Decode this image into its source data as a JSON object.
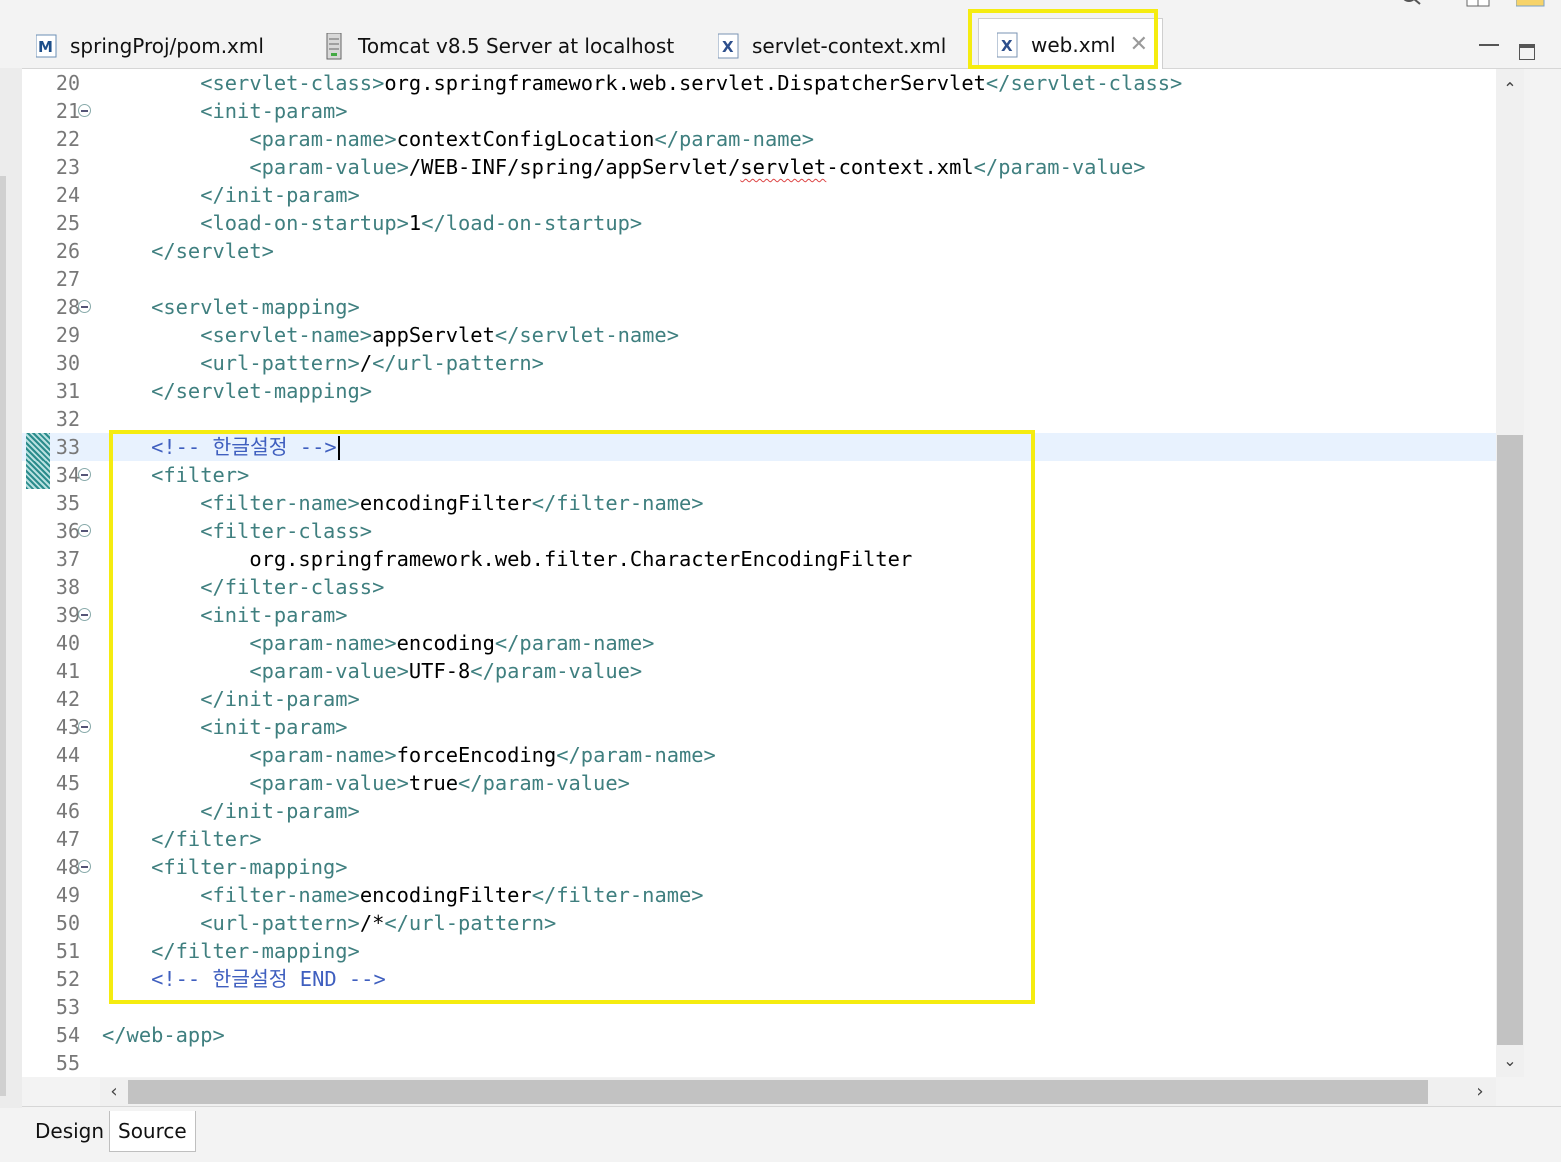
{
  "editor_tabs": [
    {
      "label": "springProj/pom.xml",
      "icon": "maven-file-icon",
      "active": false
    },
    {
      "label": "Tomcat v8.5 Server at localhost",
      "icon": "server-icon",
      "active": false
    },
    {
      "label": "servlet-context.xml",
      "icon": "xml-file-icon",
      "active": false
    },
    {
      "label": "web.xml",
      "icon": "xml-file-icon",
      "active": true
    }
  ],
  "close_glyph": "✕",
  "bottom_tabs": {
    "design": "Design",
    "source": "Source"
  },
  "colors": {
    "tag": "#3f7f7f",
    "comment": "#3f5fbf",
    "highlight": "#f5ec10",
    "cursor_line": "#e8f2fe"
  },
  "lines": [
    {
      "n": "20",
      "fold": false,
      "parts": [
        [
          "tag",
          "        <servlet-class>"
        ],
        [
          "txt",
          "org.springframework.web.servlet.DispatcherServlet"
        ],
        [
          "tag",
          "</servlet-class>"
        ]
      ]
    },
    {
      "n": "21",
      "fold": true,
      "parts": [
        [
          "tag",
          "        <init-param>"
        ]
      ]
    },
    {
      "n": "22",
      "fold": false,
      "parts": [
        [
          "tag",
          "            <param-name>"
        ],
        [
          "txt",
          "contextConfigLocation"
        ],
        [
          "tag",
          "</param-name>"
        ]
      ]
    },
    {
      "n": "23",
      "fold": false,
      "parts": [
        [
          "tag",
          "            <param-value>"
        ],
        [
          "txt",
          "/WEB-INF/spring/appServlet/"
        ],
        [
          "sq",
          "servlet"
        ],
        [
          "txt",
          "-context.xml"
        ],
        [
          "tag",
          "</param-value>"
        ]
      ]
    },
    {
      "n": "24",
      "fold": false,
      "parts": [
        [
          "tag",
          "        </init-param>"
        ]
      ]
    },
    {
      "n": "25",
      "fold": false,
      "parts": [
        [
          "tag",
          "        <load-on-startup>"
        ],
        [
          "txt",
          "1"
        ],
        [
          "tag",
          "</load-on-startup>"
        ]
      ]
    },
    {
      "n": "26",
      "fold": false,
      "parts": [
        [
          "tag",
          "    </servlet>"
        ]
      ]
    },
    {
      "n": "27",
      "fold": false,
      "parts": []
    },
    {
      "n": "28",
      "fold": true,
      "parts": [
        [
          "tag",
          "    <servlet-mapping>"
        ]
      ]
    },
    {
      "n": "29",
      "fold": false,
      "parts": [
        [
          "tag",
          "        <servlet-name>"
        ],
        [
          "txt",
          "appServlet"
        ],
        [
          "tag",
          "</servlet-name>"
        ]
      ]
    },
    {
      "n": "30",
      "fold": false,
      "parts": [
        [
          "tag",
          "        <url-pattern>"
        ],
        [
          "txt",
          "/"
        ],
        [
          "tag",
          "</url-pattern>"
        ]
      ]
    },
    {
      "n": "31",
      "fold": false,
      "parts": [
        [
          "tag",
          "    </servlet-mapping>"
        ]
      ]
    },
    {
      "n": "32",
      "fold": false,
      "parts": []
    },
    {
      "n": "33",
      "fold": false,
      "cursor": true,
      "marker": true,
      "parts": [
        [
          "cmt",
          "    <!-- 한글설정 -->"
        ]
      ]
    },
    {
      "n": "34",
      "fold": true,
      "marker": true,
      "parts": [
        [
          "tag",
          "    <filter>"
        ]
      ]
    },
    {
      "n": "35",
      "fold": false,
      "parts": [
        [
          "tag",
          "        <filter-name>"
        ],
        [
          "txt",
          "encodingFilter"
        ],
        [
          "tag",
          "</filter-name>"
        ]
      ]
    },
    {
      "n": "36",
      "fold": true,
      "parts": [
        [
          "tag",
          "        <filter-class>"
        ]
      ]
    },
    {
      "n": "37",
      "fold": false,
      "parts": [
        [
          "txt",
          "            org.springframework.web.filter.CharacterEncodingFilter"
        ]
      ]
    },
    {
      "n": "38",
      "fold": false,
      "parts": [
        [
          "tag",
          "        </filter-class>"
        ]
      ]
    },
    {
      "n": "39",
      "fold": true,
      "parts": [
        [
          "tag",
          "        <init-param>"
        ]
      ]
    },
    {
      "n": "40",
      "fold": false,
      "parts": [
        [
          "tag",
          "            <param-name>"
        ],
        [
          "txt",
          "encoding"
        ],
        [
          "tag",
          "</param-name>"
        ]
      ]
    },
    {
      "n": "41",
      "fold": false,
      "parts": [
        [
          "tag",
          "            <param-value>"
        ],
        [
          "txt",
          "UTF-8"
        ],
        [
          "tag",
          "</param-value>"
        ]
      ]
    },
    {
      "n": "42",
      "fold": false,
      "parts": [
        [
          "tag",
          "        </init-param>"
        ]
      ]
    },
    {
      "n": "43",
      "fold": true,
      "parts": [
        [
          "tag",
          "        <init-param>"
        ]
      ]
    },
    {
      "n": "44",
      "fold": false,
      "parts": [
        [
          "tag",
          "            <param-name>"
        ],
        [
          "txt",
          "forceEncoding"
        ],
        [
          "tag",
          "</param-name>"
        ]
      ]
    },
    {
      "n": "45",
      "fold": false,
      "parts": [
        [
          "tag",
          "            <param-value>"
        ],
        [
          "txt",
          "true"
        ],
        [
          "tag",
          "</param-value>"
        ]
      ]
    },
    {
      "n": "46",
      "fold": false,
      "parts": [
        [
          "tag",
          "        </init-param>"
        ]
      ]
    },
    {
      "n": "47",
      "fold": false,
      "parts": [
        [
          "tag",
          "    </filter>"
        ]
      ]
    },
    {
      "n": "48",
      "fold": true,
      "parts": [
        [
          "tag",
          "    <filter-mapping>"
        ]
      ]
    },
    {
      "n": "49",
      "fold": false,
      "parts": [
        [
          "tag",
          "        <filter-name>"
        ],
        [
          "txt",
          "encodingFilter"
        ],
        [
          "tag",
          "</filter-name>"
        ]
      ]
    },
    {
      "n": "50",
      "fold": false,
      "parts": [
        [
          "tag",
          "        <url-pattern>"
        ],
        [
          "txt",
          "/*"
        ],
        [
          "tag",
          "</url-pattern>"
        ]
      ]
    },
    {
      "n": "51",
      "fold": false,
      "parts": [
        [
          "tag",
          "    </filter-mapping>"
        ]
      ]
    },
    {
      "n": "52",
      "fold": false,
      "parts": [
        [
          "cmt",
          "    <!-- 한글설정 END -->"
        ]
      ]
    },
    {
      "n": "53",
      "fold": false,
      "parts": []
    },
    {
      "n": "54",
      "fold": false,
      "parts": [
        [
          "tag",
          "</web-app>"
        ]
      ]
    },
    {
      "n": "55",
      "fold": false,
      "parts": []
    }
  ]
}
